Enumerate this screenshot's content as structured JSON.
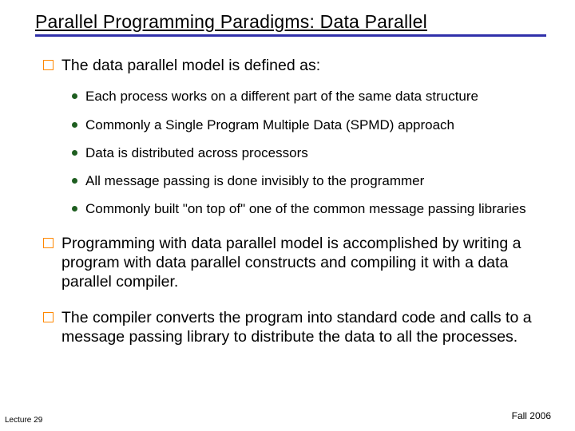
{
  "title": "Parallel Programming Paradigms:   Data Parallel",
  "top_items": [
    {
      "text": "The data parallel model is defined as:",
      "subs": [
        "Each process works on a different part of the same data structure",
        "Commonly a Single Program Multiple Data (SPMD) approach",
        "Data is distributed across processors",
        "All message passing is done invisibly to the programmer",
        "Commonly built \"on top of\" one of the common message passing libraries"
      ]
    },
    {
      "text": "Programming with data parallel model is accomplished by writing a program with data parallel constructs and compiling it with a data parallel compiler.",
      "subs": []
    },
    {
      "text": "The compiler converts the program into standard code and calls to a message passing library to distribute the data to all the processes.",
      "subs": []
    }
  ],
  "footer": {
    "left": "Lecture 29",
    "right": "Fall 2006"
  }
}
